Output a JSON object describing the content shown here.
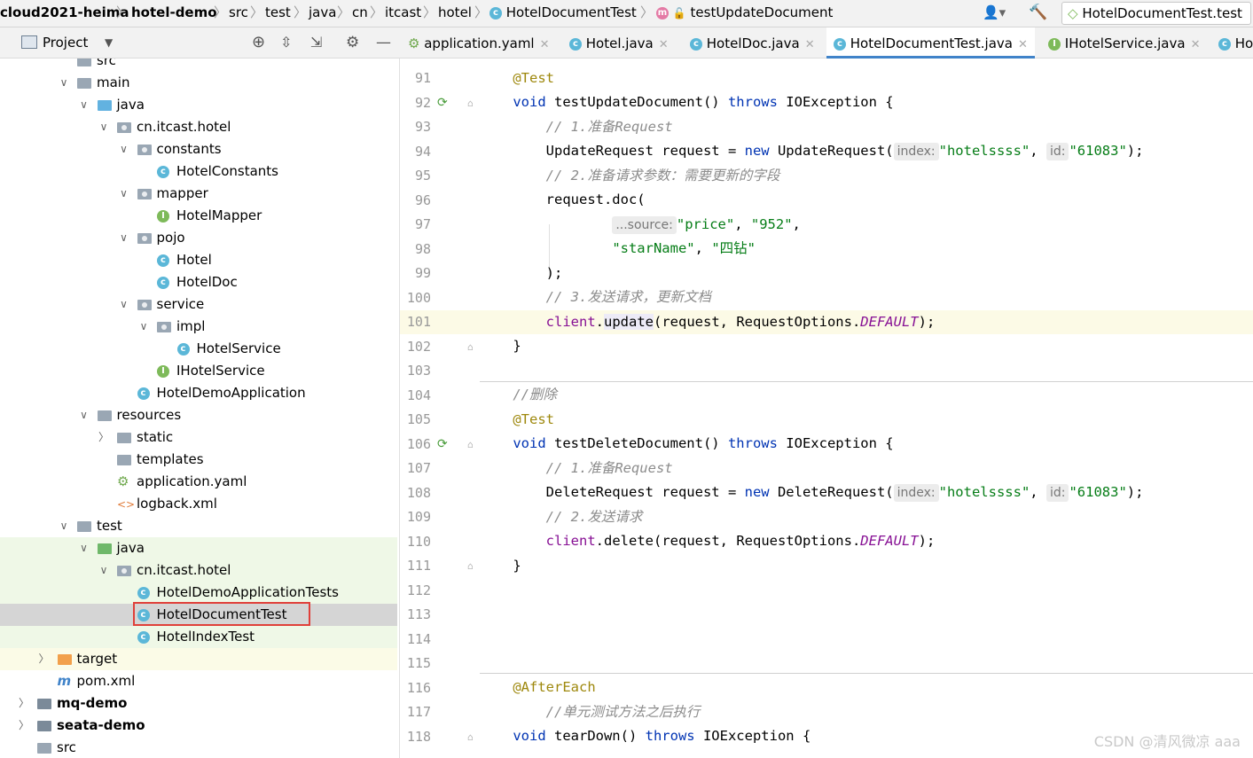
{
  "breadcrumb": {
    "items": [
      "cloud2021-heima",
      "hotel-demo",
      "src",
      "test",
      "java",
      "cn",
      "itcast",
      "hotel",
      "HotelDocumentTest",
      "testUpdateDocument"
    ],
    "run_config": "HotelDocumentTest.test"
  },
  "project_panel": {
    "title": "Project"
  },
  "tabs": [
    {
      "label": "application.yaml",
      "icon": "yaml-icon"
    },
    {
      "label": "Hotel.java",
      "icon": "class-icon"
    },
    {
      "label": "HotelDoc.java",
      "icon": "class-icon"
    },
    {
      "label": "HotelDocumentTest.java",
      "icon": "test-class-icon",
      "active": true
    },
    {
      "label": "IHotelService.java",
      "icon": "interface-icon"
    },
    {
      "label": "Ho",
      "icon": "class-icon"
    }
  ],
  "tree": [
    {
      "label": "src",
      "depth": 4,
      "type": "folder"
    },
    {
      "label": "main",
      "depth": 4,
      "type": "folder",
      "expanded": true
    },
    {
      "label": "java",
      "depth": 5,
      "type": "folder-blue",
      "expanded": true
    },
    {
      "label": "cn.itcast.hotel",
      "depth": 6,
      "type": "package",
      "expanded": true
    },
    {
      "label": "constants",
      "depth": 7,
      "type": "package",
      "expanded": true
    },
    {
      "label": "HotelConstants",
      "depth": 8,
      "type": "class"
    },
    {
      "label": "mapper",
      "depth": 7,
      "type": "package",
      "expanded": true
    },
    {
      "label": "HotelMapper",
      "depth": 8,
      "type": "interface"
    },
    {
      "label": "pojo",
      "depth": 7,
      "type": "package",
      "expanded": true
    },
    {
      "label": "Hotel",
      "depth": 8,
      "type": "class"
    },
    {
      "label": "HotelDoc",
      "depth": 8,
      "type": "class"
    },
    {
      "label": "service",
      "depth": 7,
      "type": "package",
      "expanded": true
    },
    {
      "label": "impl",
      "depth": 8,
      "type": "package",
      "expanded": true
    },
    {
      "label": "HotelService",
      "depth": 9,
      "type": "class"
    },
    {
      "label": "IHotelService",
      "depth": 8,
      "type": "interface"
    },
    {
      "label": "HotelDemoApplication",
      "depth": 7,
      "type": "spring-class"
    },
    {
      "label": "resources",
      "depth": 5,
      "type": "folder",
      "expanded": true
    },
    {
      "label": "static",
      "depth": 6,
      "type": "folder",
      "collapsed": true
    },
    {
      "label": "templates",
      "depth": 6,
      "type": "folder"
    },
    {
      "label": "application.yaml",
      "depth": 6,
      "type": "yaml"
    },
    {
      "label": "logback.xml",
      "depth": 6,
      "type": "xml"
    },
    {
      "label": "test",
      "depth": 4,
      "type": "folder",
      "expanded": true
    },
    {
      "label": "java",
      "depth": 5,
      "type": "folder-green",
      "expanded": true,
      "bg": "green"
    },
    {
      "label": "cn.itcast.hotel",
      "depth": 6,
      "type": "package",
      "expanded": true,
      "bg": "green"
    },
    {
      "label": "HotelDemoApplicationTests",
      "depth": 7,
      "type": "test-class",
      "bg": "green"
    },
    {
      "label": "HotelDocumentTest",
      "depth": 7,
      "type": "test-class",
      "bg": "sel",
      "highlighted": true
    },
    {
      "label": "HotelIndexTest",
      "depth": 7,
      "type": "test-class",
      "bg": "green"
    },
    {
      "label": "target",
      "depth": 3,
      "type": "folder-orange",
      "collapsed": true,
      "bg": "yellow"
    },
    {
      "label": "pom.xml",
      "depth": 3,
      "type": "maven"
    },
    {
      "label": "mq-demo",
      "depth": 2,
      "type": "module",
      "collapsed": true,
      "bold": true
    },
    {
      "label": "seata-demo",
      "depth": 2,
      "type": "module",
      "collapsed": true,
      "bold": true
    },
    {
      "label": "src",
      "depth": 2,
      "type": "folder"
    }
  ],
  "line_numbers": [
    "91",
    "92",
    "93",
    "94",
    "95",
    "96",
    "97",
    "98",
    "99",
    "100",
    "101",
    "102",
    "103",
    "104",
    "105",
    "106",
    "107",
    "108",
    "109",
    "110",
    "111",
    "112",
    "113",
    "114",
    "115",
    "116",
    "117",
    "118"
  ],
  "code": {
    "l91": {
      "ann": "@Test"
    },
    "l92": {
      "kw1": "void",
      "name": " testUpdateDocument() ",
      "kw2": "throws",
      "rest": " IOException {"
    },
    "l93": {
      "cmt": "// 1.准备Request"
    },
    "l94": {
      "pre": "UpdateRequest request = ",
      "kw": "new",
      "mid": " UpdateRequest(",
      "hint1": "index:",
      "s1": "\"hotelssss\"",
      "sep": ", ",
      "hint2": "id:",
      "s2": "\"61083\"",
      "end": ");"
    },
    "l95": {
      "cmt": "// 2.准备请求参数：需要更新的字段"
    },
    "l96": {
      "text": "request.doc("
    },
    "l97": {
      "hint": "...source:",
      "s1": "\"price\"",
      "sep": ", ",
      "s2": "\"952\"",
      "end": ","
    },
    "l98": {
      "s1": "\"starName\"",
      "sep": ", ",
      "s2": "\"四钻\""
    },
    "l99": {
      "text": ");"
    },
    "l100": {
      "cmt": "// 3.发送请求，更新文档"
    },
    "l101": {
      "fld": "client",
      "dot": ".",
      "m": "update",
      "mid": "(request, RequestOptions.",
      "sfld": "DEFAULT",
      "end": ");"
    },
    "l102": {
      "text": "}"
    },
    "l104": {
      "cmt": "//删除"
    },
    "l105": {
      "ann": "@Test"
    },
    "l106": {
      "kw1": "void",
      "name": " testDeleteDocument() ",
      "kw2": "throws",
      "rest": " IOException {"
    },
    "l107": {
      "cmt": "// 1.准备Request"
    },
    "l108": {
      "pre": "DeleteRequest request = ",
      "kw": "new",
      "mid": " DeleteRequest(",
      "hint1": "index:",
      "s1": "\"hotelssss\"",
      "sep": ", ",
      "hint2": "id:",
      "s2": "\"61083\"",
      "end": ");"
    },
    "l109": {
      "cmt": "// 2.发送请求"
    },
    "l110": {
      "fld": "client",
      "dot": ".",
      "m": "delete",
      "mid": "(request, RequestOptions.",
      "sfld": "DEFAULT",
      "end": ");"
    },
    "l111": {
      "text": "}"
    },
    "l116": {
      "ann": "@AfterEach"
    },
    "l117": {
      "cmt": "//单元测试方法之后执行"
    },
    "l118": {
      "kw1": "void",
      "name": " tearDown() ",
      "kw2": "throws",
      "rest": " IOException {"
    }
  },
  "watermark": "CSDN @清风微凉 aaa",
  "colors": {
    "accent": "#4083c9",
    "highlight_box": "#e0403a",
    "test_green": "#eff8e7"
  }
}
